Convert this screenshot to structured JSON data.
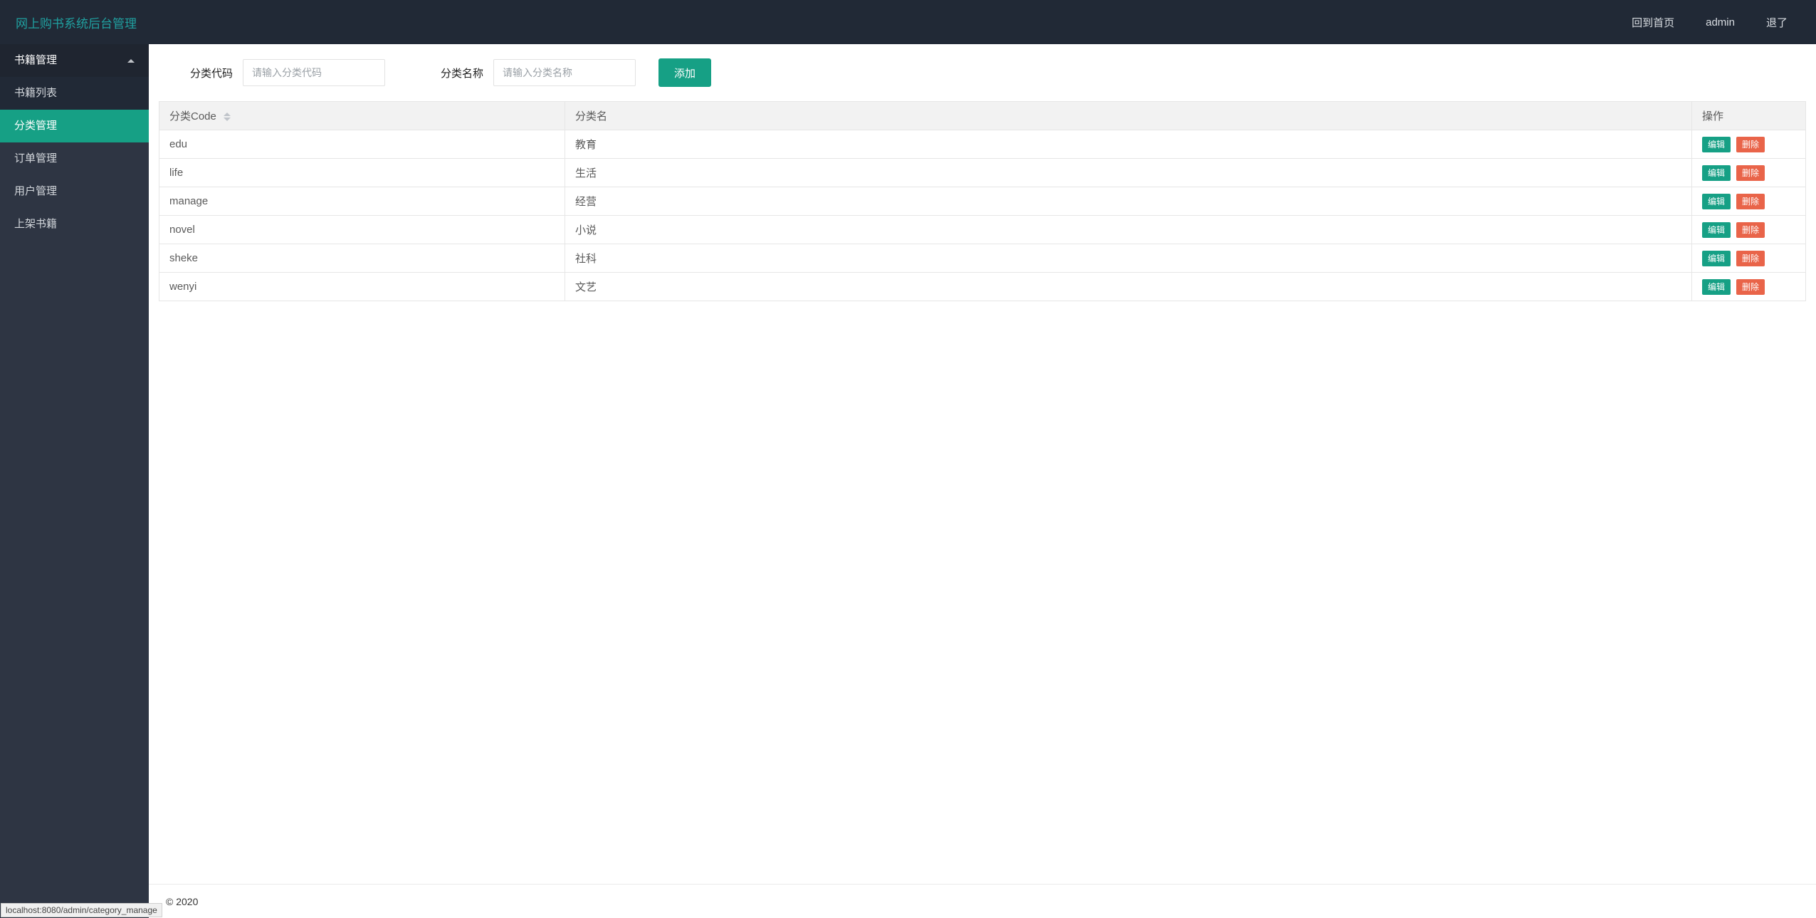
{
  "header": {
    "title": "网上购书系统后台管理",
    "links": {
      "home": "回到首页",
      "user": "admin",
      "logout": "退了"
    }
  },
  "sidebar": {
    "group_header": "书籍管理",
    "items": [
      {
        "label": "书籍列表",
        "active": false,
        "sub": true
      },
      {
        "label": "分类管理",
        "active": true,
        "sub": true
      },
      {
        "label": "订单管理",
        "active": false,
        "sub": false
      },
      {
        "label": "用户管理",
        "active": false,
        "sub": false
      },
      {
        "label": "上架书籍",
        "active": false,
        "sub": false
      }
    ]
  },
  "form": {
    "code_label": "分类代码",
    "code_placeholder": "请输入分类代码",
    "name_label": "分类名称",
    "name_placeholder": "请输入分类名称",
    "add_button": "添加"
  },
  "table": {
    "columns": {
      "code": "分类Code",
      "name": "分类名",
      "action": "操作"
    },
    "actions": {
      "edit": "编辑",
      "delete": "删除"
    },
    "rows": [
      {
        "code": "edu",
        "name": "教育"
      },
      {
        "code": "life",
        "name": "生活"
      },
      {
        "code": "manage",
        "name": "经营"
      },
      {
        "code": "novel",
        "name": "小说"
      },
      {
        "code": "sheke",
        "name": "社科"
      },
      {
        "code": "wenyi",
        "name": "文艺"
      }
    ]
  },
  "footer": {
    "copyright": "© 2020"
  },
  "status_bar": "localhost:8080/admin/category_manage"
}
